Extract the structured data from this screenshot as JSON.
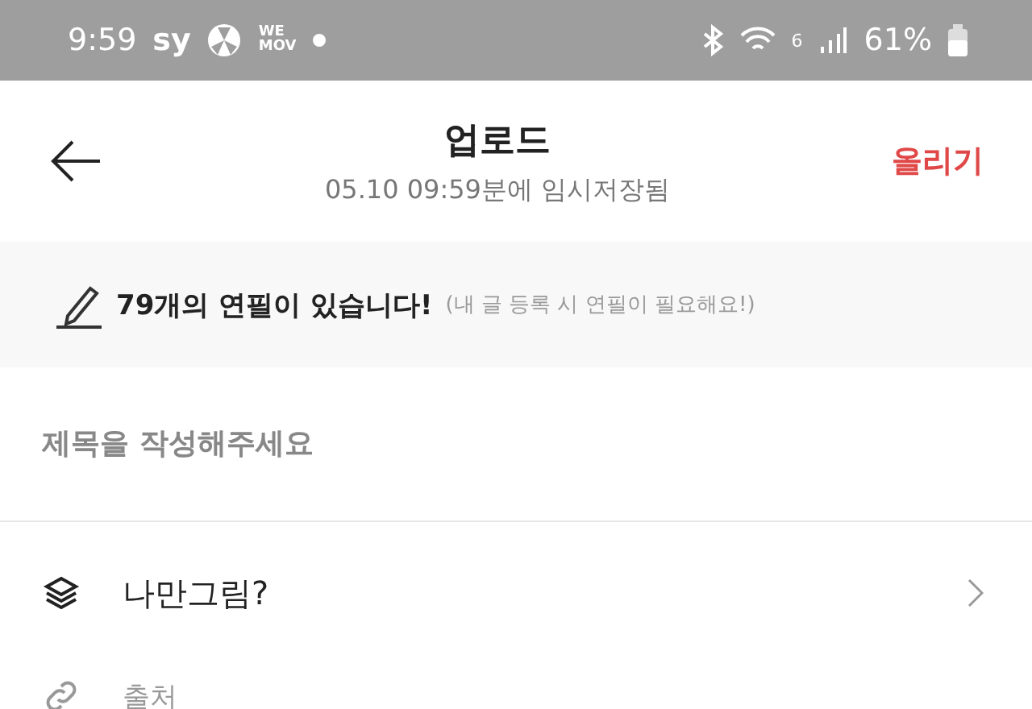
{
  "status_bar": {
    "time": "9:59",
    "carrier": "sy",
    "app_badge": "WE MOV",
    "wifi_band": "6",
    "battery": "61%"
  },
  "header": {
    "title": "업로드",
    "subtitle": "05.10 09:59분에 임시저장됨",
    "action": "올리기"
  },
  "banner": {
    "message": "79개의 연필이 있습니다!",
    "note": "(내 글 등록 시 연필이 필요해요!)"
  },
  "title_field": {
    "placeholder": "제목을 작성해주세요"
  },
  "options": [
    {
      "kind": "layers",
      "label": "나만그림?",
      "chevron": true
    },
    {
      "kind": "link",
      "label": "출처",
      "chevron": false
    }
  ]
}
